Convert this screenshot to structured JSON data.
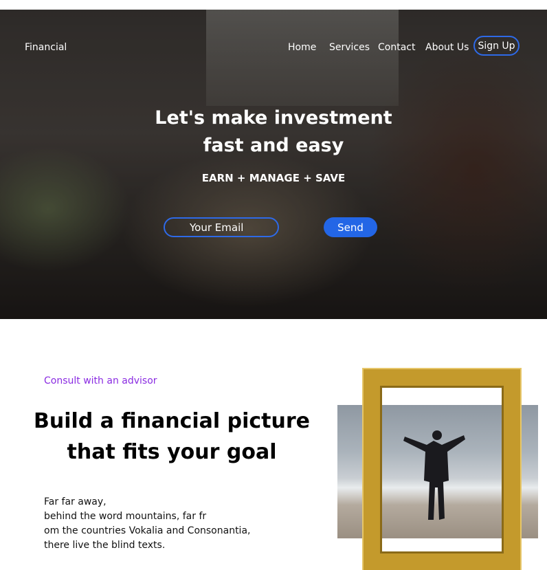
{
  "nav": {
    "brand": "Financial",
    "links": [
      "Home",
      "Services",
      "Contact",
      "About Us"
    ],
    "signup": "Sign Up"
  },
  "hero": {
    "headline_line1": "Let's make investment",
    "headline_line2": "fast and easy",
    "tagline": "EARN + MANAGE + SAVE",
    "email_placeholder": "Your Email",
    "send_label": "Send"
  },
  "about": {
    "kicker": "Consult with an advisor",
    "title_line1": "Build a financial picture",
    "title_line2": "that fits your goal",
    "body_lines": [
      "Far far away,",
      "behind the word mountains, far fr",
      "om the countries Vokalia and Consonantia,",
      "there live the blind texts."
    ]
  },
  "colors": {
    "accent": "#2366e6",
    "kicker": "#8a2be2",
    "frame": "#c49a2c"
  }
}
